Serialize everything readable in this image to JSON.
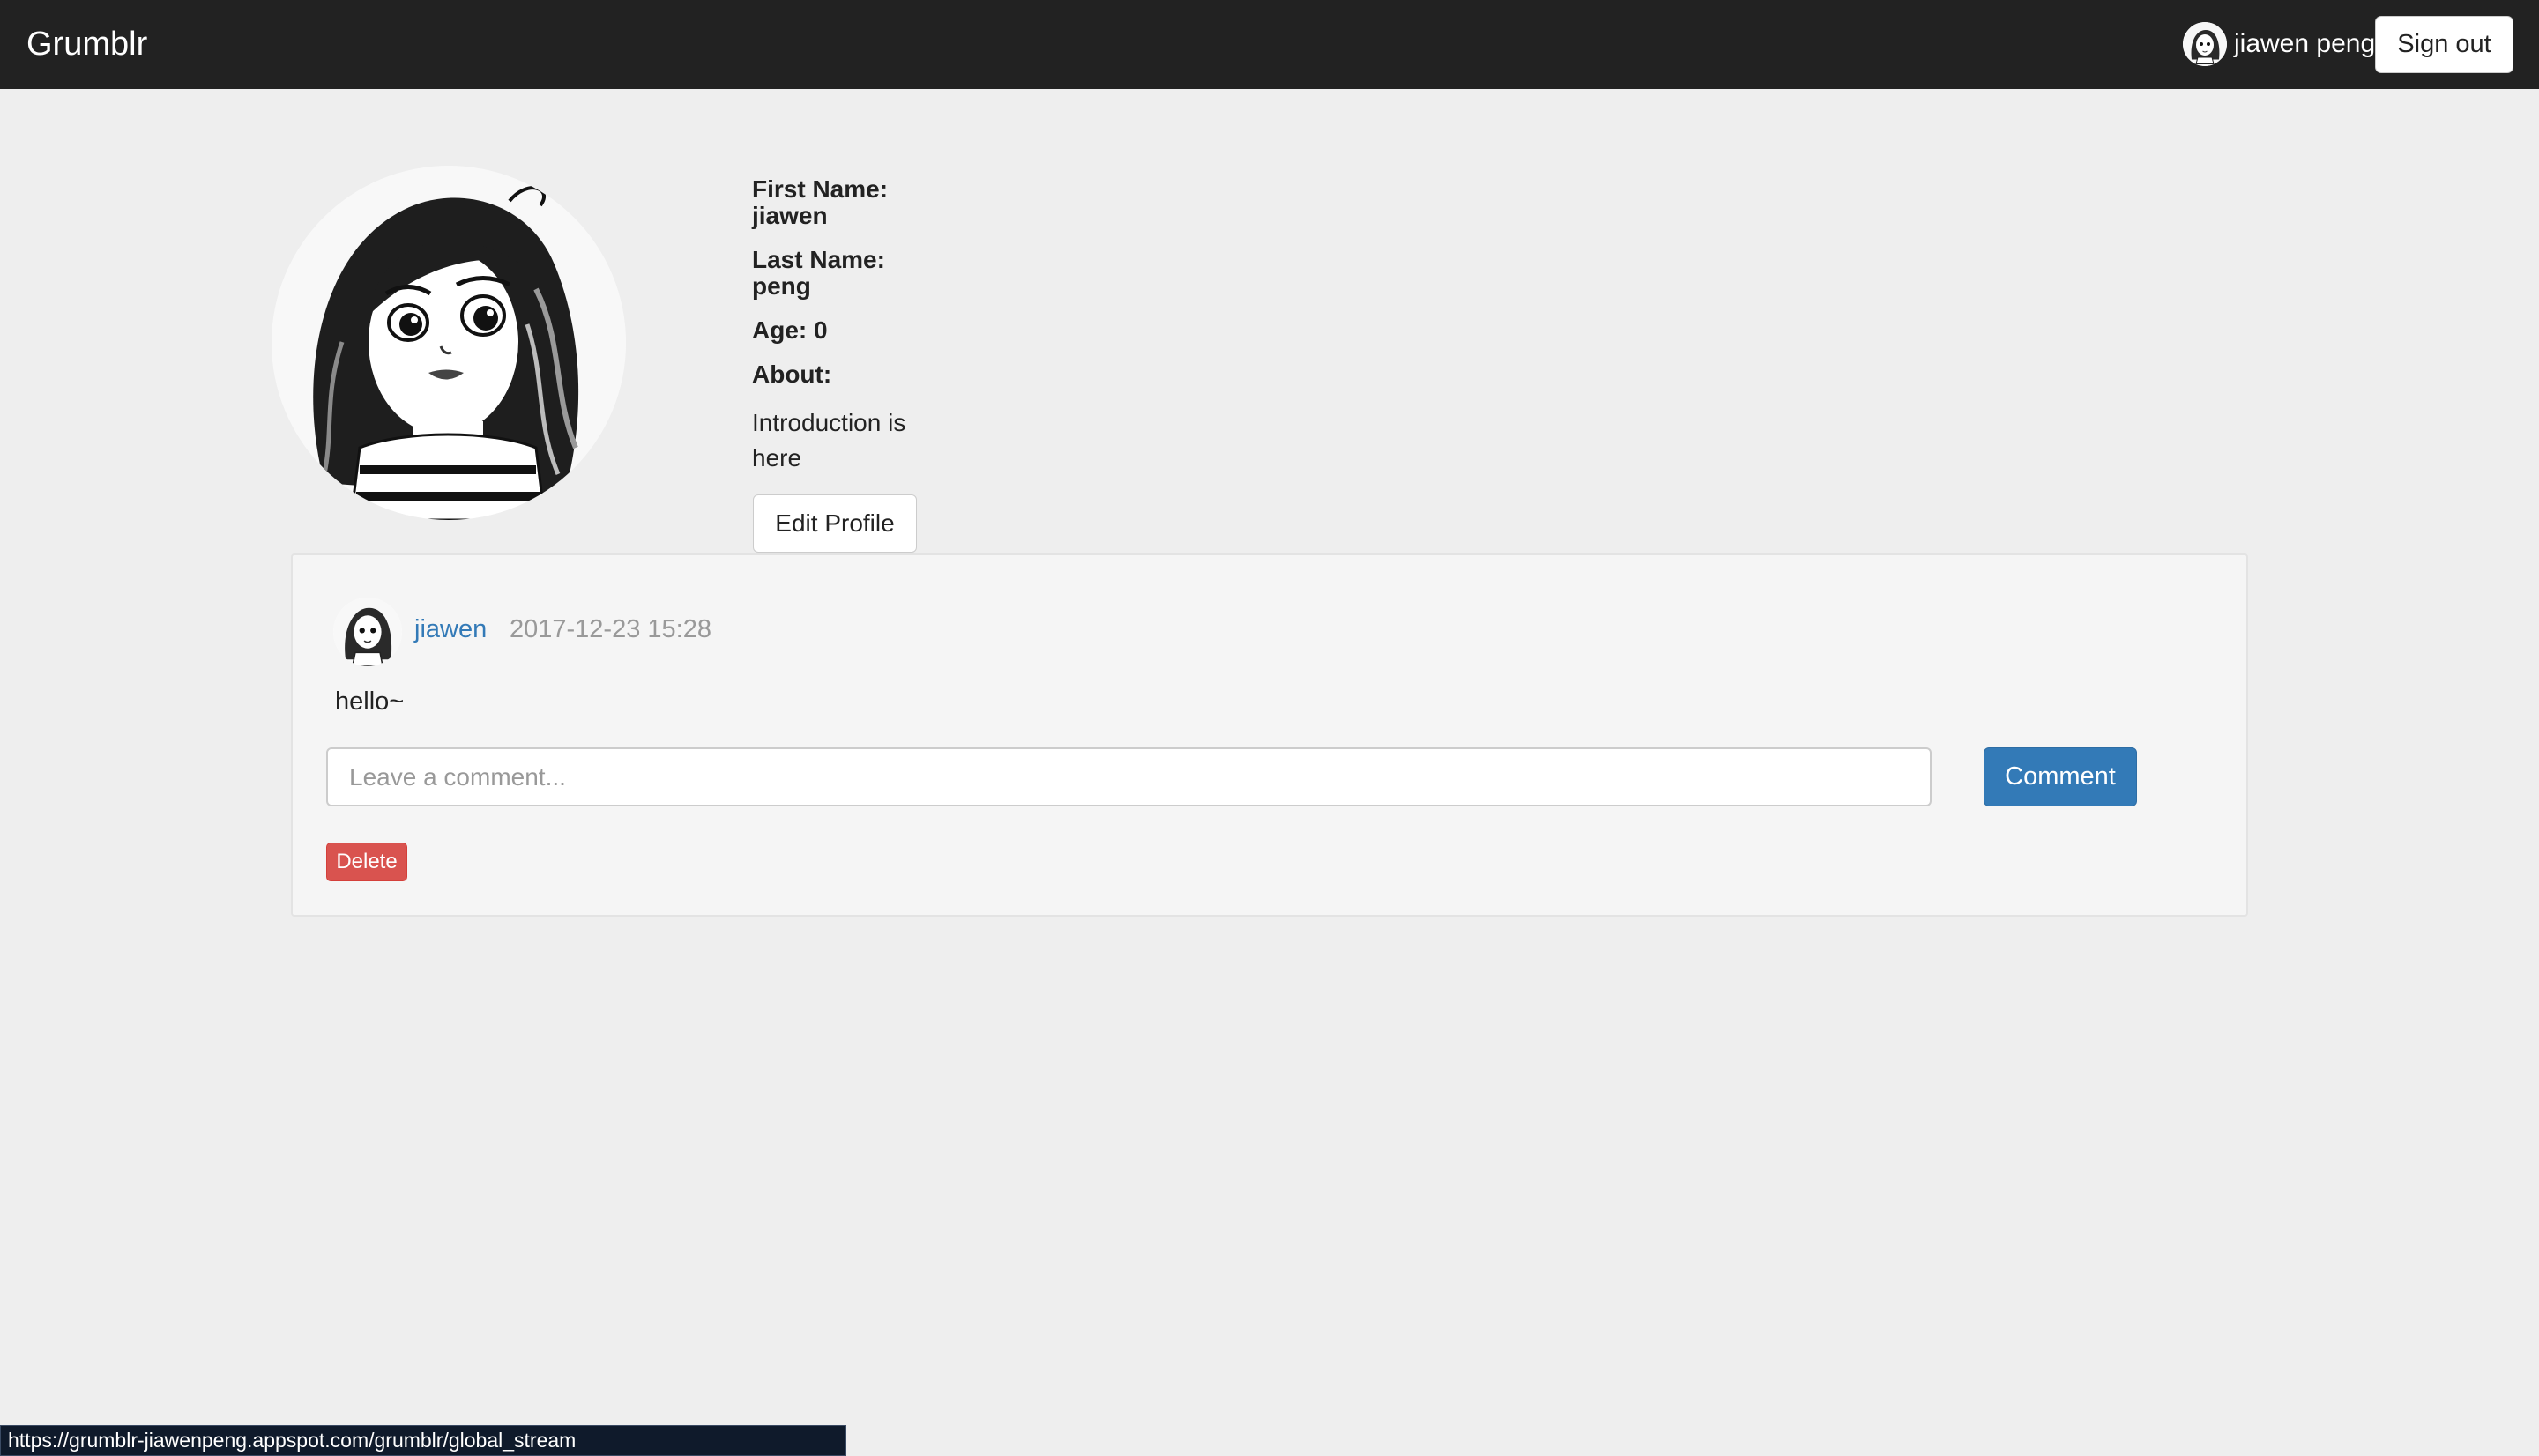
{
  "navbar": {
    "brand": "Grumblr",
    "user_name": "jiawen peng",
    "signout_label": "Sign out"
  },
  "profile": {
    "first_name_label": "First Name:",
    "first_name": "jiawen",
    "last_name_label": "Last Name:",
    "last_name": "peng",
    "age_label": "Age: 0",
    "about_label": "About:",
    "about_text": "Introduction is here",
    "edit_label": "Edit Profile"
  },
  "post": {
    "author": "jiawen",
    "timestamp": "2017-12-23 15:28",
    "body": "hello~",
    "comment_placeholder": "Leave a comment...",
    "comment_label": "Comment",
    "delete_label": "Delete"
  },
  "status_bar": {
    "url": "https://grumblr-jiawenpeng.appspot.com/grumblr/global_stream"
  },
  "colors": {
    "navbar": "#222222",
    "page_bg": "#eeeeee",
    "primary": "#337ab7",
    "danger": "#d9534f"
  }
}
